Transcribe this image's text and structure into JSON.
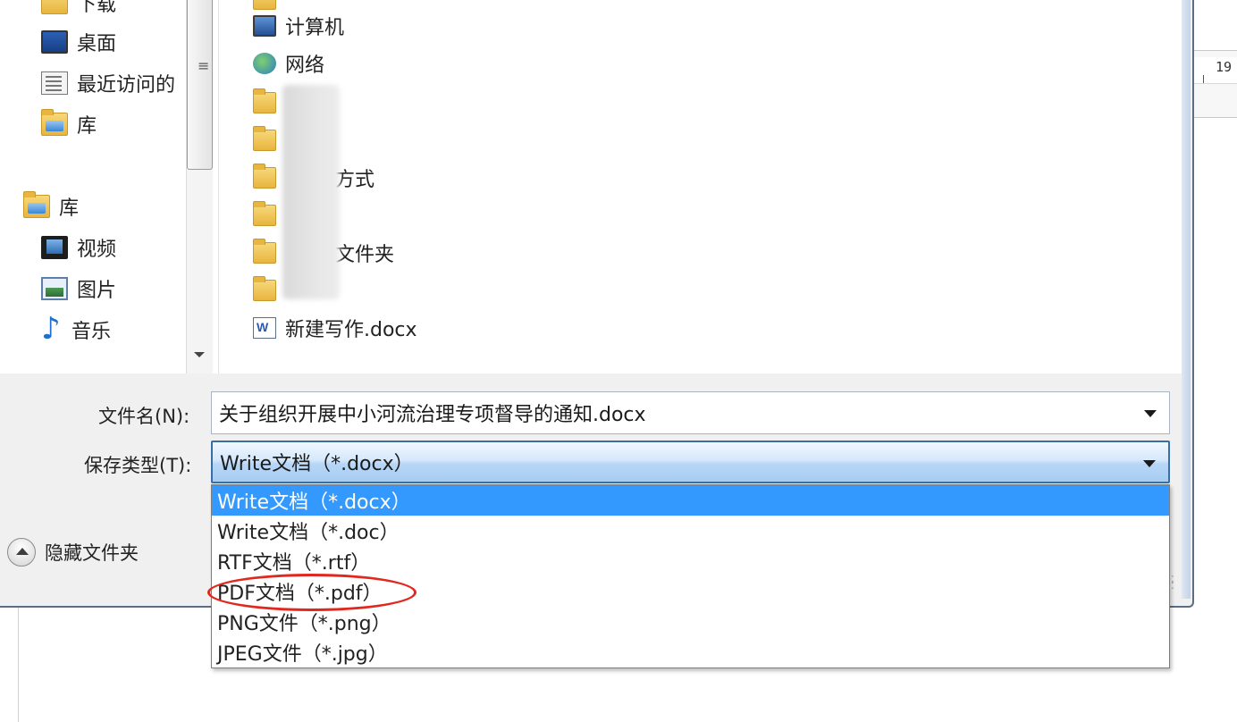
{
  "nav": {
    "items": [
      {
        "label": "下载",
        "icon": "download-folder-icon"
      },
      {
        "label": "桌面",
        "icon": "desktop-icon"
      },
      {
        "label": "最近访问的",
        "icon": "recent-places-icon"
      },
      {
        "label": "库",
        "icon": "library-folder-icon"
      },
      {
        "label": "库",
        "icon": "library-folder-icon"
      },
      {
        "label": "视频",
        "icon": "video-icon"
      },
      {
        "label": "图片",
        "icon": "picture-icon"
      },
      {
        "label": "音乐",
        "icon": "music-icon"
      }
    ]
  },
  "files": {
    "items": [
      {
        "label": "计算机",
        "icon": "computer-icon"
      },
      {
        "label": "网络",
        "icon": "network-icon"
      },
      {
        "label": "",
        "icon": "folder-icon"
      },
      {
        "label": "",
        "icon": "folder-icon"
      },
      {
        "label": "方式",
        "icon": "folder-icon"
      },
      {
        "label": "",
        "icon": "folder-icon"
      },
      {
        "label": "文件夹",
        "icon": "folder-icon"
      },
      {
        "label": "",
        "icon": "folder-icon"
      },
      {
        "label": "新建写作.docx",
        "icon": "docx-file-icon"
      }
    ]
  },
  "form": {
    "filename_label": "文件名(N):",
    "filename_value": "关于组织开展中小河流治理专项督导的通知.docx",
    "savetype_label": "保存类型(T):",
    "savetype_value": "Write文档（*.docx）",
    "savetype_options": [
      "Write文档（*.docx）",
      "Write文档（*.doc）",
      "RTF文档（*.rtf）",
      "PDF文档（*.pdf）",
      "PNG文件（*.png）",
      "JPEG文件（*.jpg）"
    ],
    "hide_folders_label": "隐藏文件夹"
  },
  "background": {
    "ruler_text": "19"
  },
  "colors": {
    "selection": "#3399ff",
    "highlight_annotation": "#e0281e"
  }
}
